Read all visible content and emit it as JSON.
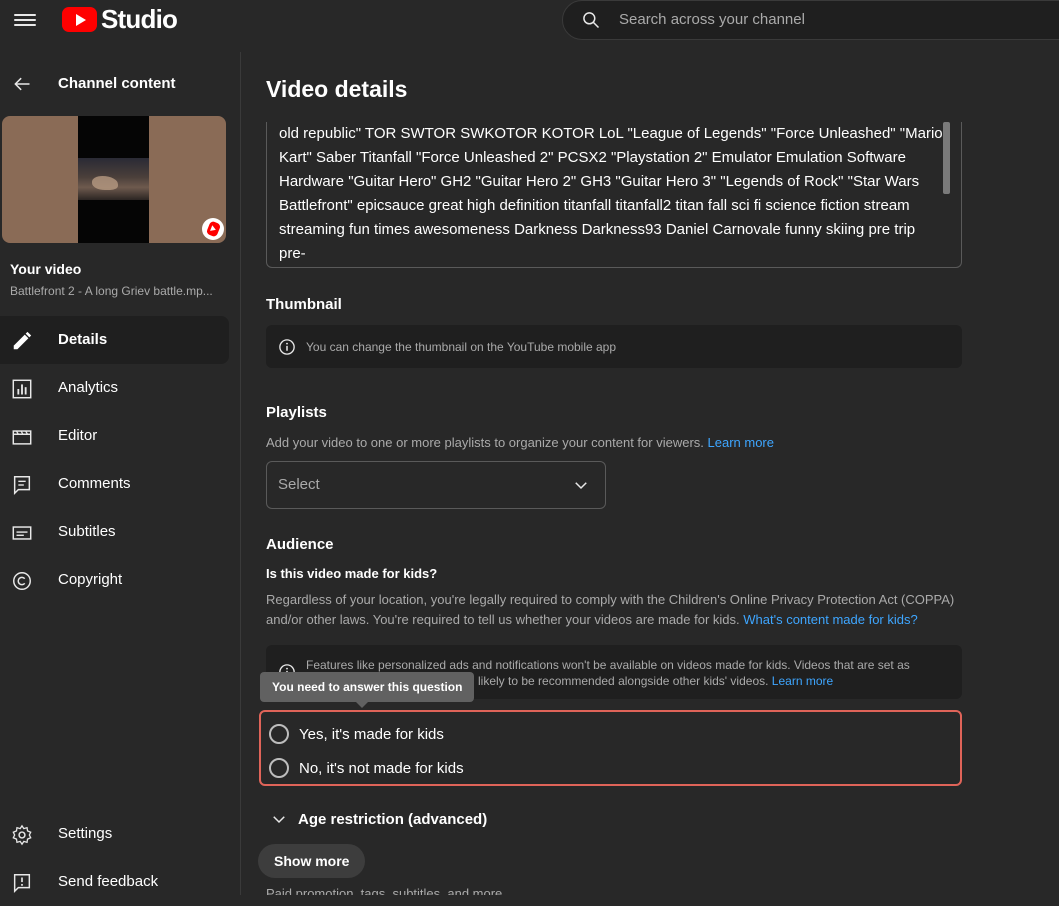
{
  "app": {
    "logo_text": "Studio"
  },
  "search": {
    "placeholder": "Search across your channel"
  },
  "sidebar": {
    "back_label": "Channel content",
    "your_video_label": "Your video",
    "video_filename": "Battlefront 2 - A long Griev battle.mp...",
    "items": [
      {
        "label": "Details",
        "icon": "pencil-icon",
        "active": true
      },
      {
        "label": "Analytics",
        "icon": "analytics-icon",
        "active": false
      },
      {
        "label": "Editor",
        "icon": "editor-icon",
        "active": false
      },
      {
        "label": "Comments",
        "icon": "comments-icon",
        "active": false
      },
      {
        "label": "Subtitles",
        "icon": "subtitles-icon",
        "active": false
      },
      {
        "label": "Copyright",
        "icon": "copyright-icon",
        "active": false
      }
    ],
    "bottom_items": [
      {
        "label": "Settings",
        "icon": "gear-icon"
      },
      {
        "label": "Send feedback",
        "icon": "feedback-icon"
      }
    ]
  },
  "main": {
    "title": "Video details",
    "tags_text": "old republic\" TOR SWTOR SWKOTOR KOTOR LoL \"League of Legends\" \"Force Unleashed\" \"Mario\nKart\" Saber Titanfall \"Force Unleashed 2\" PCSX2 \"Playstation 2\" Emulator Emulation Software\nHardware \"Guitar Hero\" GH2 \"Guitar Hero 2\" GH3 \"Guitar Hero 3\" \"Legends of Rock\" \"Star Wars\nBattlefront\" epicsauce great high definition titanfall titanfall2 titan fall sci fi science fiction stream\nstreaming fun times awesomeness Darkness Darkness93 Daniel Carnovale funny skiing pre trip pre-",
    "thumbnail": {
      "title": "Thumbnail",
      "info": "You can change the thumbnail on the YouTube mobile app"
    },
    "playlists": {
      "title": "Playlists",
      "description": "Add your video to one or more playlists to organize your content for viewers.",
      "learn_more": "Learn more",
      "select_label": "Select"
    },
    "audience": {
      "title": "Audience",
      "question": "Is this video made for kids?",
      "description_1": "Regardless of your location, you're legally required to comply with the Children's Online Privacy Protection Act (COPPA)",
      "description_2": "and/or other laws. You're required to tell us whether your videos are made for kids.",
      "description_link": "What's content made for kids?",
      "info_line_1": "Features like personalized ads and notifications won't be available on videos made for kids. Videos that are set as",
      "info_line_2": "likely to be recommended alongside other kids' videos.",
      "info_link": "Learn more",
      "tooltip": "You need to answer this question",
      "option_yes": "Yes, it's made for kids",
      "option_no": "No, it's not made for kids"
    },
    "age_restriction": "Age restriction (advanced)",
    "show_more": "Show more",
    "cut_off_text": "Paid promotion, tags, subtitles, and more"
  },
  "colors": {
    "accent_red": "#ff0000",
    "error_border": "#e06459",
    "link": "#3ea6ff",
    "background": "#282828"
  }
}
